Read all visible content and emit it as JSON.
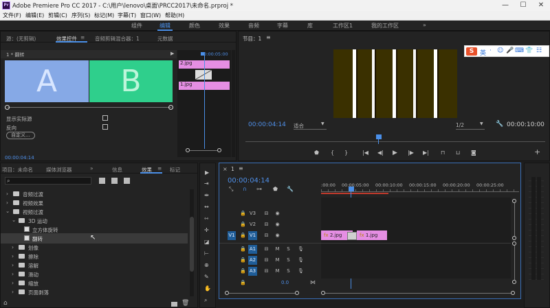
{
  "window": {
    "app_icon": "Pr",
    "title": "Adobe Premiere Pro CC 2017 - C:\\用户\\lenovo\\桌面\\PRCC2017\\未命名.prproj *"
  },
  "menu": [
    "文件(F)",
    "编辑(E)",
    "剪辑(C)",
    "序列(S)",
    "标记(M)",
    "字幕(T)",
    "窗口(W)",
    "帮助(H)"
  ],
  "workspaces": {
    "items": [
      "组件",
      "编辑",
      "颜色",
      "效果",
      "音频",
      "字幕",
      "库",
      "工作区1",
      "我的工作区"
    ],
    "active": "编辑",
    "more": "»"
  },
  "effect_controls": {
    "tabs": [
      "源：(无剪辑)",
      "效果控件",
      "音频剪辑混合器：1",
      "元数据"
    ],
    "active_tab": "效果控件",
    "clip_name": "1 * 翻转",
    "preview_left": "A",
    "preview_right": "B",
    "ruler_time": "00:00:05:00",
    "clip_a": "2.jpg",
    "clip_b": "1.jpg",
    "checkbox_show_actual": "显示实际源",
    "checkbox_reverse": "反向",
    "custom_button": "自定义...",
    "timecode": "00:00:04:14"
  },
  "program_monitor": {
    "title": "节目：1",
    "timecode": "00:00:04:14",
    "fit": "适合",
    "resolution": "1/2",
    "duration": "00:00:10:00"
  },
  "sogou_bar": {
    "logo": "S",
    "mode": "英",
    "items": [
      "·",
      "☺",
      "🎤",
      "⌨",
      "👕",
      "☷"
    ]
  },
  "project_panel": {
    "tabs": [
      "项目：未命名",
      "媒体浏览器",
      "信息",
      "效果",
      "标记"
    ],
    "active_tab": "效果",
    "tree": [
      {
        "label": "音频过渡",
        "level": 0,
        "expanded": false
      },
      {
        "label": "视频效果",
        "level": 0,
        "expanded": false
      },
      {
        "label": "视频过渡",
        "level": 0,
        "expanded": true
      },
      {
        "label": "3D 运动",
        "level": 1,
        "expanded": true
      },
      {
        "label": "立方体旋转",
        "level": 2,
        "expanded": false
      },
      {
        "label": "翻转",
        "level": 2,
        "expanded": false,
        "selected": true
      },
      {
        "label": "划像",
        "level": 1,
        "expanded": false
      },
      {
        "label": "擦除",
        "level": 1,
        "expanded": false
      },
      {
        "label": "溶解",
        "level": 1,
        "expanded": false
      },
      {
        "label": "滑动",
        "level": 1,
        "expanded": false
      },
      {
        "label": "缩放",
        "level": 1,
        "expanded": false
      },
      {
        "label": "页面剥落",
        "level": 1,
        "expanded": false
      }
    ]
  },
  "timeline": {
    "sequence_name": "1",
    "timecode": "00:00:04:14",
    "ruler": [
      ":00:00",
      "00:00:05:00",
      "00:00:10:00",
      "00:00:15:00",
      "00:00:20:00",
      "00:00:25:00"
    ],
    "video_tracks": [
      "V3",
      "V2",
      "V1"
    ],
    "audio_tracks": [
      "A1",
      "A2",
      "A3"
    ],
    "mute_label": "M",
    "solo_label": "S",
    "master_value": "0.0",
    "clips": [
      {
        "label": "2.jpg",
        "track": "V1"
      },
      {
        "label": "1.jpg",
        "track": "V1"
      }
    ],
    "clip_color": "#e58ee3",
    "playhead_color": "#4a8fe8"
  },
  "colors": {
    "accent": "#4a8fe8",
    "preview_a": "#86a9e6",
    "preview_b": "#2fcf8c",
    "clip": "#e58ee3",
    "video_bg": "#3a3000"
  }
}
